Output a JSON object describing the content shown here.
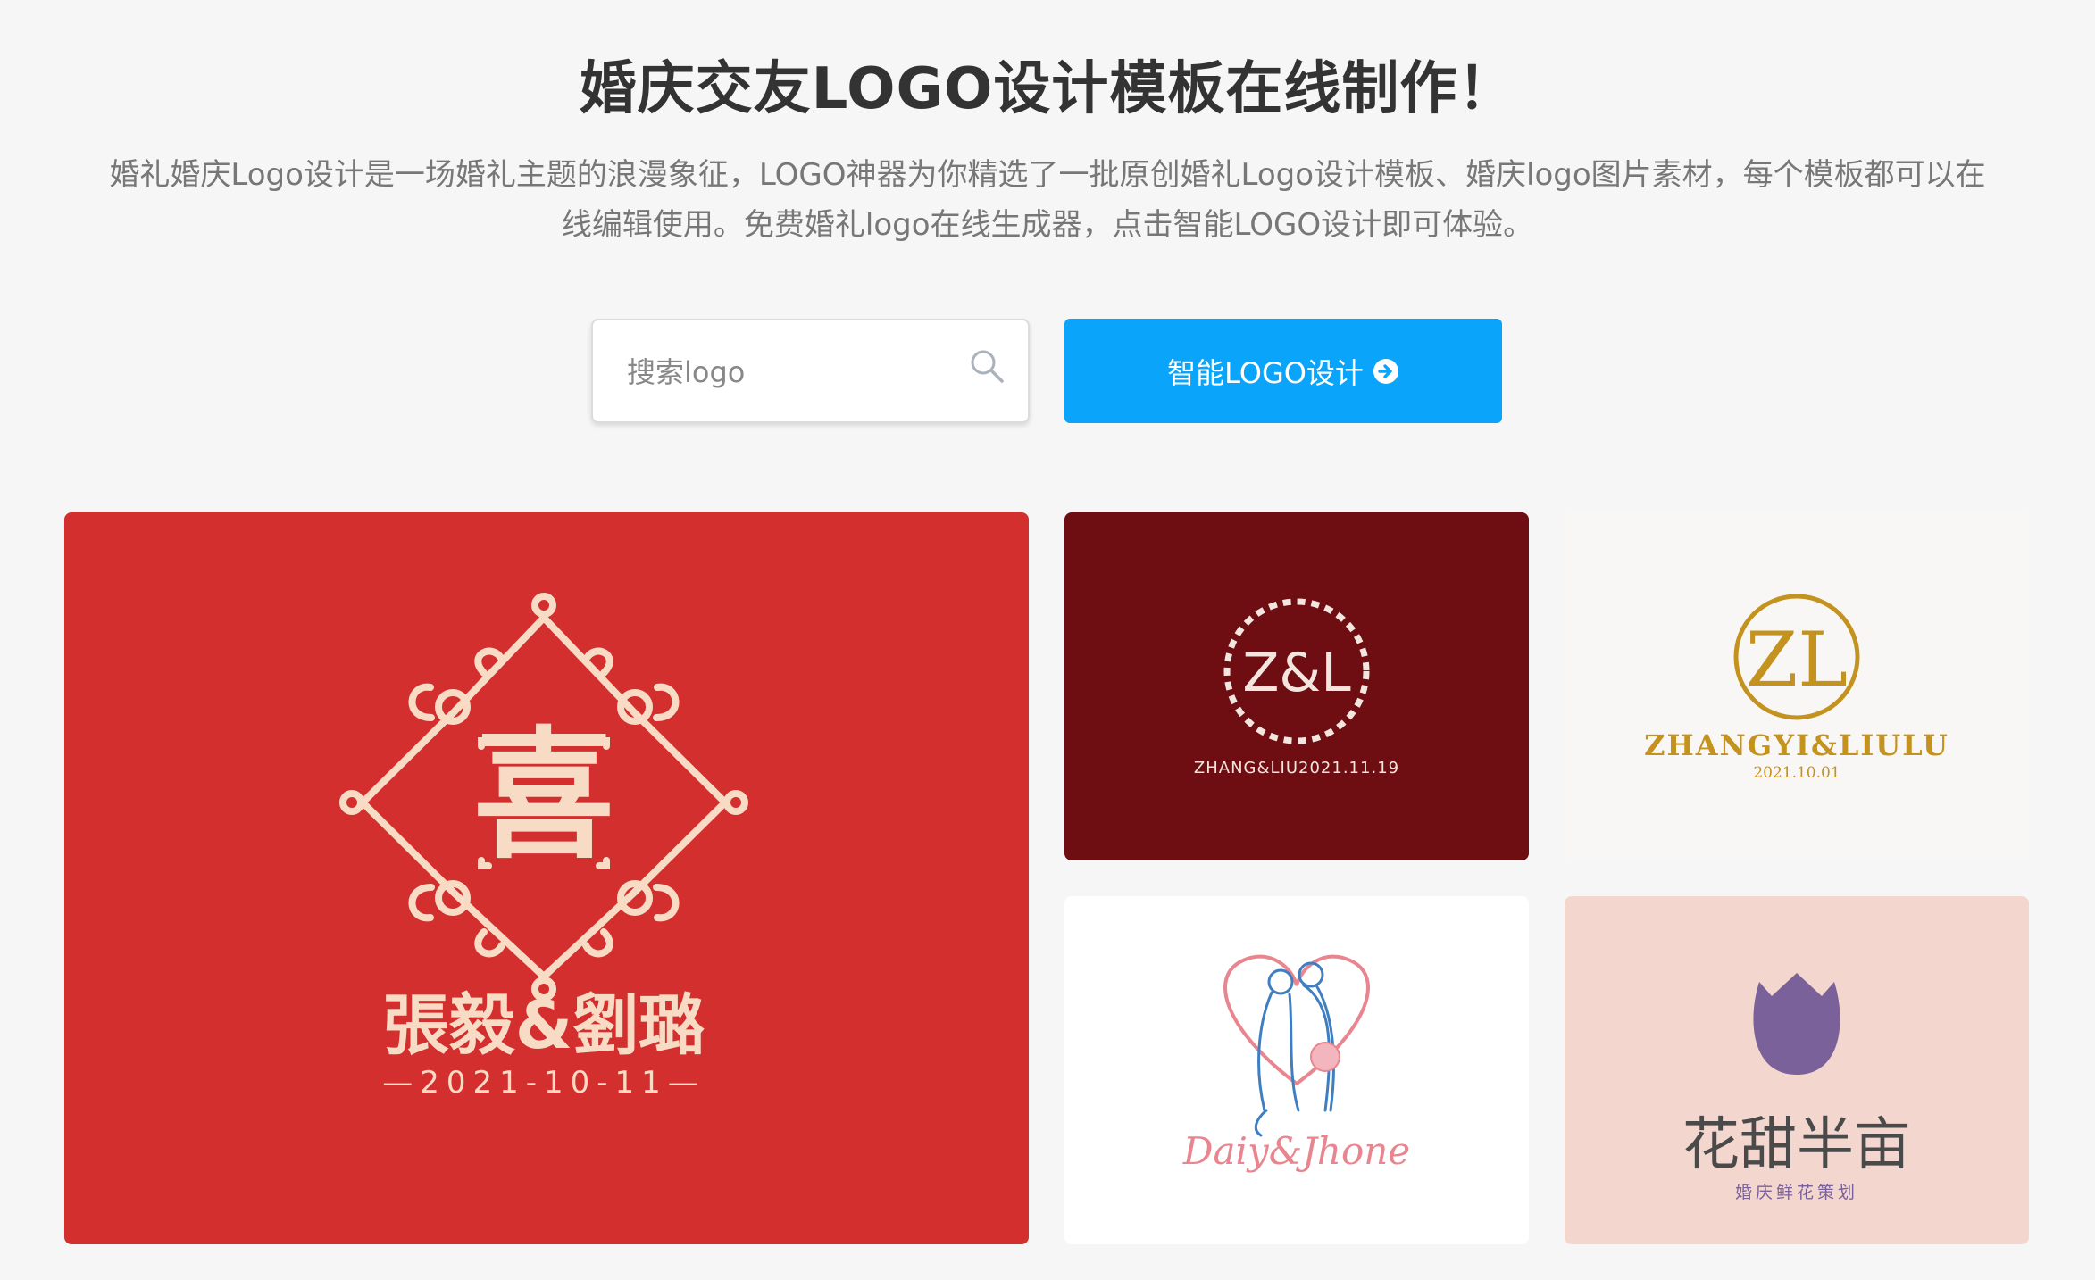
{
  "header": {
    "title": "婚庆交友LOGO设计模板在线制作！",
    "description_line1": "婚礼婚庆Logo设计是一场婚礼主题的浪漫象征，LOGO神器为你精选了一批原创婚礼Logo设计模板、婚庆logo图片素材，每个模板都可以在",
    "description_line2": "线编辑使用。免费婚礼logo在线生成器，点击智能LOGO设计即可体验。"
  },
  "search": {
    "placeholder": "搜索logo",
    "value": ""
  },
  "cta": {
    "label": "智能LOGO设计"
  },
  "colors": {
    "accent": "#0aa5fa",
    "card1_bg": "#d32f2f",
    "card1_fg": "#f8dbc4",
    "card2_bg": "#6e0e12",
    "card3_bg": "#f9f7f5",
    "card3_gold": "#c4931f",
    "card5_bg": "#f3d6ce",
    "card5_purple": "#7b6199"
  },
  "templates": [
    {
      "id": "card1",
      "logo_glyph": "喜",
      "name": "張毅&劉璐",
      "date": "—2021-10-11—"
    },
    {
      "id": "card2",
      "monogram": "Z&L",
      "subtitle": "ZHANG&LIU2021.11.19"
    },
    {
      "id": "card3",
      "monogram": "ZL",
      "name": "ZHANGYI&LIULU",
      "date": "2021.10.01"
    },
    {
      "id": "card4",
      "script": "Daiy&Jhone"
    },
    {
      "id": "card5",
      "name": "花甜半亩",
      "subtitle": "婚庆鲜花策划"
    }
  ]
}
